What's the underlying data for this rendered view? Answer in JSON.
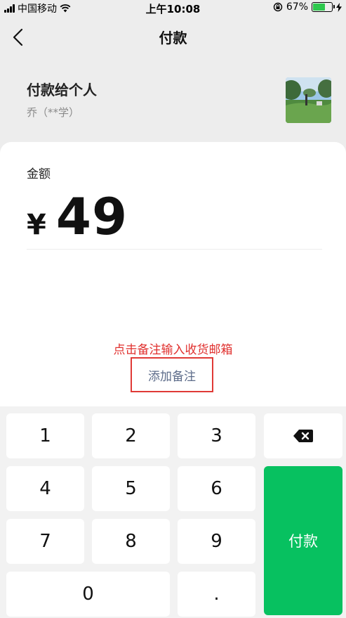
{
  "status_bar": {
    "carrier": "中国移动",
    "time": "上午10:08",
    "battery_percent": "67%",
    "battery_level": 0.67,
    "battery_color": "#2dc84d"
  },
  "nav": {
    "title": "付款",
    "back_icon": "chevron-left-icon"
  },
  "payee": {
    "title": "付款给个人",
    "name": "乔（**学）"
  },
  "amount": {
    "label": "金额",
    "currency": "¥",
    "value": "49"
  },
  "remark": {
    "annotation": "点击备注输入收货邮箱",
    "button_label": "添加备注"
  },
  "keypad": {
    "keys": [
      "1",
      "2",
      "3",
      "4",
      "5",
      "6",
      "7",
      "8",
      "9",
      "0",
      "."
    ],
    "backspace_icon": "backspace-icon",
    "pay_label": "付款",
    "pay_color": "#07c160"
  }
}
